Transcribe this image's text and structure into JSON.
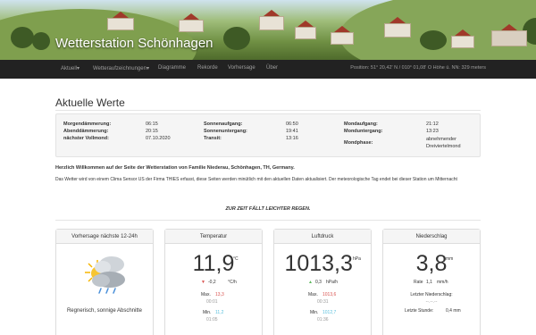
{
  "header": {
    "site_title": "Wetterstation Schönhagen"
  },
  "nav": {
    "items": [
      "Aktuell",
      "Wetteraufzeichnungen",
      "Diagramme",
      "Rekorde",
      "Vorhersage",
      "Über"
    ],
    "dropdown_arrow": "▾",
    "position_text": "Position: 51° 20,42' N / 010° 01,08' O  Höhe ü. NN: 329 meters"
  },
  "main": {
    "title": "Aktuelle Werte",
    "values": {
      "col1": [
        {
          "label": "Morgendämmerung:",
          "value": "06:15"
        },
        {
          "label": "Abenddämmerung:",
          "value": "20:15"
        },
        {
          "label": "nächster Vollmond:",
          "value": "07.10.2020"
        }
      ],
      "col2": [
        {
          "label": "Sonnenaufgang:",
          "value": "06:50"
        },
        {
          "label": "Sonnenuntergang:",
          "value": "19:41"
        },
        {
          "label": "Transit:",
          "value": "13:16"
        }
      ],
      "col3": [
        {
          "label": "Mondaufgang:",
          "value": "21:12"
        },
        {
          "label": "Monduntergang:",
          "value": "13:23"
        },
        {
          "label": "Mondphase:",
          "value": "abnehmender Dreiviertelmond"
        }
      ]
    },
    "welcome": "Herzlich Willkommen auf der Seite der Wetterstation von Familie Niederau, Schönhagen, TH, Germany.",
    "description": "Das Wetter wird von einem Clima Sensor US der Firma THIES erfasst, diese Seiten werden minütlich mit den aktuellen Daten aktualisiert. Der meteorologische Tag endet bei dieser Station um Mitternacht",
    "forecast_note": "ZUR ZEIT FÄLLT LEICHTER REGEN."
  },
  "panels": {
    "forecast": {
      "title": "Vorhersage nächste 12-24h",
      "text": "Regnerisch, sonnige Abschnitte",
      "icon": "rain-sun-cloud-icon"
    },
    "temperature": {
      "title": "Temperatur",
      "value": "11,9",
      "unit": "°C",
      "trend": "-0,2",
      "trend_unit": "°C/h",
      "trend_dir": "▼",
      "max_label": "Max.",
      "max_value": "13,3",
      "max_time": "00:01",
      "min_label": "Min.",
      "min_value": "11,2",
      "min_time": "01:05"
    },
    "pressure": {
      "title": "Luftdruck",
      "value": "1013,3",
      "unit": "hPa",
      "trend": "0,3",
      "trend_unit": "hPa/h",
      "trend_dir": "▲",
      "max_label": "Max.",
      "max_value": "1013,6",
      "max_time": "00:31",
      "min_label": "Min.",
      "min_value": "1012,7",
      "min_time": "01:36"
    },
    "rain": {
      "title": "Niederschlag",
      "value": "3,8",
      "unit": "mm",
      "rate_label": "Rate",
      "rate_value": "1,1",
      "rate_unit": "mm/h",
      "last_label": "Letzter Niederschlag:",
      "last_value": "--.--.--",
      "lasthour_label": "Letzte Stunde:",
      "lasthour_value": "0,4 mm"
    }
  },
  "colors": {
    "navbar": "#222222",
    "max": "#d9534f",
    "min": "#5bc0de",
    "trend_down": "#d9534f",
    "trend_up": "#5cb85c"
  }
}
